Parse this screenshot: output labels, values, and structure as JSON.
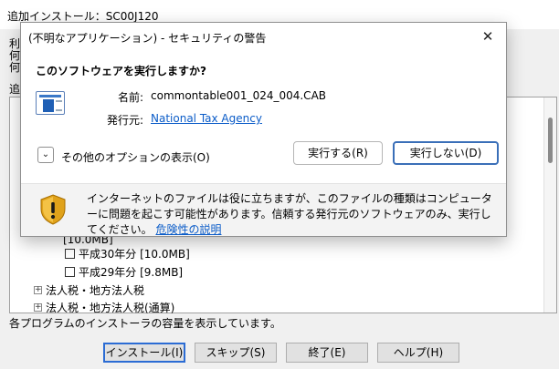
{
  "background": {
    "window_title": "追加インストール：SC00J120",
    "stub_lines": [
      "利",
      "何",
      "何"
    ],
    "tree_label_stub": "追",
    "tree_items": [
      {
        "type": "checkbox",
        "label": "平成30年分 [10.0MB]"
      },
      {
        "type": "checkbox",
        "label": "平成29年分 [9.8MB]"
      },
      {
        "type": "expander",
        "label": "法人税・地方法人税"
      },
      {
        "type": "expander",
        "label": "法人税・地方法人税(通算)"
      }
    ],
    "partial_item": "[10.0MB]",
    "status_text": "各プログラムのインストーラの容量を表示しています。",
    "buttons": {
      "install": "インストール(I)",
      "skip": "スキップ(S)",
      "finish": "終了(E)",
      "help": "ヘルプ(H)"
    }
  },
  "dialog": {
    "title": "(不明なアプリケーション) - セキュリティの警告",
    "close_glyph": "✕",
    "question": "このソフトウェアを実行しますか?",
    "name_label": "名前:",
    "name_value": "commontable001_024_004.CAB",
    "publisher_label": "発行元:",
    "publisher_value": "National Tax Agency",
    "options_glyph": "⌄",
    "options_label": "その他のオプションの表示(O)",
    "run_button": "実行する(R)",
    "dont_run_button": "実行しない(D)",
    "warning_text": "インターネットのファイルは役に立ちますが、このファイルの種類はコンピューターに問題を起こす可能性があります。信頼する発行元のソフトウェアのみ、実行してください。",
    "risk_link": "危険性の説明",
    "accent_color": "#3a6fb8",
    "link_color": "#0b5cc8"
  }
}
